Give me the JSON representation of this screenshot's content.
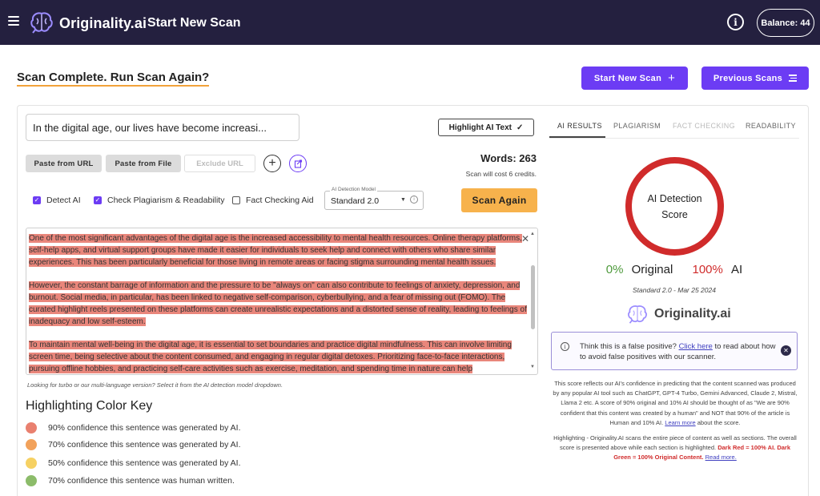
{
  "topbar": {
    "brand": "Originality.ai",
    "page_title": "Start New Scan",
    "balance": "Balance: 44"
  },
  "header": {
    "scan_complete": "Scan Complete. Run Scan Again?",
    "start_new_scan": "Start New Scan",
    "previous_scans": "Previous Scans"
  },
  "editor": {
    "title_value": "In the digital age, our lives have become increasi...",
    "highlight_ai_text": "Highlight AI Text",
    "paste_from_url": "Paste from URL",
    "paste_from_file": "Paste from File",
    "exclude_url": "Exclude URL",
    "words": "Words: 263",
    "cost": "Scan will cost 6 credits.",
    "checks": {
      "detect_ai": "Detect AI",
      "plagiarism": "Check Plagiarism & Readability",
      "fact_checking": "Fact Checking Aid"
    },
    "model_legend": "AI Detection Model",
    "model_value": "Standard 2.0",
    "scan_again": "Scan Again",
    "paragraphs": [
      "One of the most significant advantages of the digital age is the increased accessibility to mental health resources. Online therapy platforms, self-help apps, and virtual support groups have made it easier for individuals to seek help and connect with others who share similar experiences. This has been particularly beneficial for those living in remote areas or facing stigma surrounding mental health issues.",
      "However, the constant barrage of information and the pressure to be \"always on\" can also contribute to feelings of anxiety, depression, and burnout. Social media, in particular, has been linked to negative self-comparison, cyberbullying, and a fear of missing out (FOMO). The curated highlight reels presented on these platforms can create unrealistic expectations and a distorted sense of reality, leading to feelings of inadequacy and low self-esteem.",
      "To maintain mental well-being in the digital age, it is essential to set boundaries and practice digital mindfulness. This can involve limiting screen time, being selective about the content consumed, and engaging in regular digital detoxes. Prioritizing face-to-face interactions, pursuing offline hobbies, and practicing self-care activities such as exercise, meditation, and spending time in nature can help counterbalance the negative"
    ],
    "turbo_note": "Looking for turbo or our multi-language version? Select it from the AI detection model dropdown."
  },
  "color_key": {
    "title": "Highlighting Color Key",
    "items": [
      {
        "label": "90% confidence this sentence was generated by AI.",
        "color": "#e9806f"
      },
      {
        "label": "70% confidence this sentence was generated by AI.",
        "color": "#f2a25b"
      },
      {
        "label": "50% confidence this sentence was generated by AI.",
        "color": "#f6d163"
      },
      {
        "label": "70% confidence this sentence was human written.",
        "color": "#8cbc6a"
      }
    ]
  },
  "results": {
    "tabs": [
      "AI RESULTS",
      "PLAGIARISM",
      "FACT CHECKING",
      "READABILITY"
    ],
    "score_label": "AI Detection Score",
    "original_pct": "0%",
    "original_label": "Original",
    "ai_pct": "100%",
    "ai_label": "AI",
    "model_date": "Standard 2.0 - Mar 25 2024",
    "logo_text": "Originality.ai",
    "false_positive": {
      "lead": "Think this is a false positive? ",
      "link": "Click here",
      "tail": " to read about how to avoid false positives with our scanner."
    },
    "explanation": "This score reflects our AI's confidence in predicting that the content scanned was produced by any popular AI tool such as ChatGPT, GPT-4 Turbo, Gemini Advanced, Claude 2, Mistral, Llama 2 etc. A score of 90% original and 10% AI should be thought of as \"We are 90% confident that this content was created by a human\" and NOT that 90% of the article is Human and 10% AI.",
    "learn_more": "Learn more",
    "explanation_tail": " about the score.",
    "highlighting_text": "Highlighting - Originality.AI scans the entire piece of content as well as sections. The overall score is presented above while each section is highlighted. ",
    "highlighting_red": "Dark Red = 100% AI. Dark Green = 100% Original Content.",
    "read_more": "Read more."
  },
  "colors": {
    "topbar": "#24203f",
    "accent": "#6c3cf4",
    "scan_button": "#f7b24c",
    "score_ring": "#d02b2b",
    "highlight": "#e9867b"
  }
}
